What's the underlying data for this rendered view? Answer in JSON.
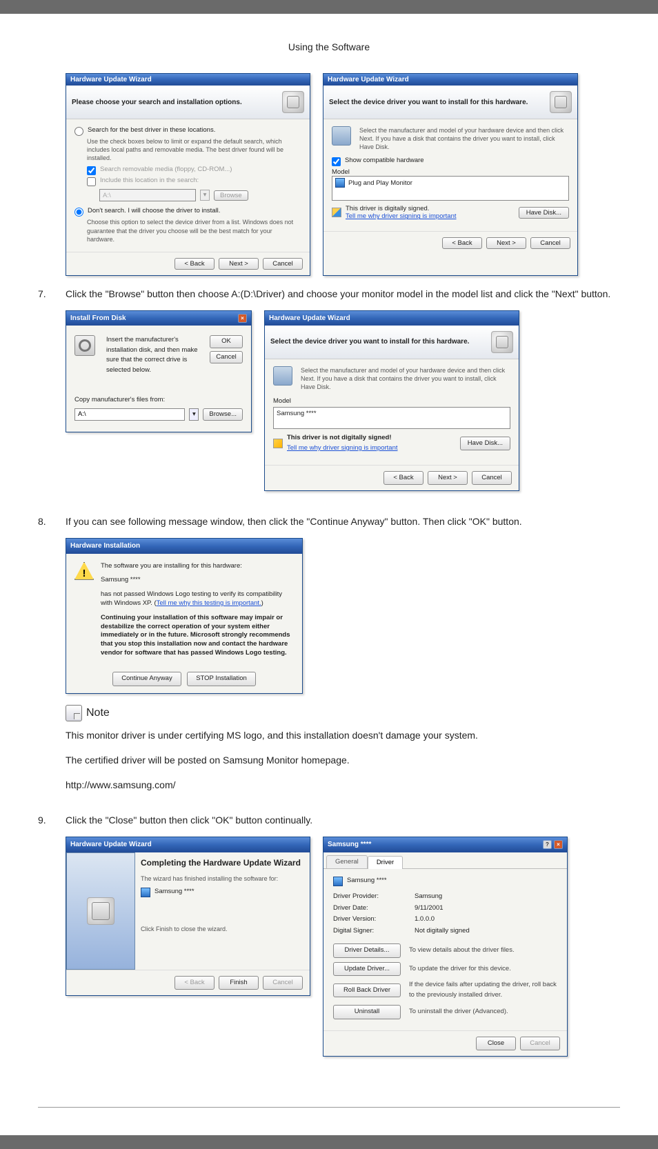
{
  "page": {
    "header": "Using the Software"
  },
  "step7": {
    "num": "7.",
    "text": "Click the \"Browse\" button then choose A:(D:\\Driver) and choose your monitor model in the model list and click the \"Next\" button."
  },
  "step8": {
    "num": "8.",
    "text": "If you can see following message window, then click the \"Continue Anyway\" button. Then click \"OK\" button."
  },
  "step9": {
    "num": "9.",
    "text": "Click the \"Close\" button then click \"OK\" button continually."
  },
  "note": {
    "label": "Note",
    "p1": "This monitor driver is under certifying MS logo, and this installation doesn't damage your system.",
    "p2": "The certified driver will be posted on Samsung Monitor homepage.",
    "p3": "http://www.samsung.com/"
  },
  "wiz_a": {
    "title": "Hardware Update Wizard",
    "header": "Please choose your search and installation options.",
    "r1": "Search for the best driver in these locations.",
    "r1h": "Use the check boxes below to limit or expand the default search, which includes local paths and removable media. The best driver found will be installed.",
    "c1": "Search removable media (floppy, CD-ROM...)",
    "c2": "Include this location in the search:",
    "path": "A:\\",
    "browse": "Browse",
    "r2": "Don't search. I will choose the driver to install.",
    "r2h": "Choose this option to select the device driver from a list. Windows does not guarantee that the driver you choose will be the best match for your hardware.",
    "back": "< Back",
    "next": "Next >",
    "cancel": "Cancel"
  },
  "wiz_b": {
    "title": "Hardware Update Wizard",
    "header": "Select the device driver you want to install for this hardware.",
    "desc": "Select the manufacturer and model of your hardware device and then click Next. If you have a disk that contains the driver you want to install, click Have Disk.",
    "showcompat": "Show compatible hardware",
    "model_lbl": "Model",
    "model": "Plug and Play Monitor",
    "signed": "This driver is digitally signed.",
    "tell": "Tell me why driver signing is important",
    "have": "Have Disk...",
    "back": "< Back",
    "next": "Next >",
    "cancel": "Cancel"
  },
  "install_from": {
    "title": "Install From Disk",
    "text": "Insert the manufacturer's installation disk, and then make sure that the correct drive is selected below.",
    "ok": "OK",
    "cancel": "Cancel",
    "copy_lbl": "Copy manufacturer's files from:",
    "path": "A:\\",
    "browse": "Browse..."
  },
  "wiz_b2": {
    "title": "Hardware Update Wizard",
    "header": "Select the device driver you want to install for this hardware.",
    "desc": "Select the manufacturer and model of your hardware device and then click Next. If you have a disk that contains the driver you want to install, click Have Disk.",
    "model_lbl": "Model",
    "model": "Samsung ****",
    "notsigned": "This driver is not digitally signed!",
    "tell": "Tell me why driver signing is important",
    "have": "Have Disk...",
    "back": "< Back",
    "next": "Next >",
    "cancel": "Cancel"
  },
  "hwinstall": {
    "title": "Hardware Installation",
    "p1a": "The software you are installing for this hardware:",
    "p1b": "Samsung ****",
    "p2": "has not passed Windows Logo testing to verify its compatibility with Windows XP. (",
    "p2link": "Tell me why this testing is important.",
    "p2end": ")",
    "p3": "Continuing your installation of this software may impair or destabilize the correct operation of your system either immediately or in the future. Microsoft strongly recommends that you stop this installation now and contact the hardware vendor for software that has passed Windows Logo testing.",
    "cont": "Continue Anyway",
    "stop": "STOP Installation"
  },
  "wiz_done": {
    "title": "Hardware Update Wizard",
    "h": "Completing the Hardware Update Wizard",
    "sub": "The wizard has finished installing the software for:",
    "mon": "Samsung ****",
    "fin": "Click Finish to close the wizard.",
    "back": "< Back",
    "finish": "Finish",
    "cancel": "Cancel"
  },
  "props": {
    "title": "Samsung ****",
    "tab_general": "General",
    "tab_driver": "Driver",
    "mon": "Samsung ****",
    "k_prov": "Driver Provider:",
    "v_prov": "Samsung",
    "k_date": "Driver Date:",
    "v_date": "9/11/2001",
    "k_ver": "Driver Version:",
    "v_ver": "1.0.0.0",
    "k_sig": "Digital Signer:",
    "v_sig": "Not digitally signed",
    "b_details": "Driver Details...",
    "t_details": "To view details about the driver files.",
    "b_update": "Update Driver...",
    "t_update": "To update the driver for this device.",
    "b_roll": "Roll Back Driver",
    "t_roll": "If the device fails after updating the driver, roll back to the previously installed driver.",
    "b_uninst": "Uninstall",
    "t_uninst": "To uninstall the driver (Advanced).",
    "close": "Close",
    "cancel": "Cancel"
  }
}
